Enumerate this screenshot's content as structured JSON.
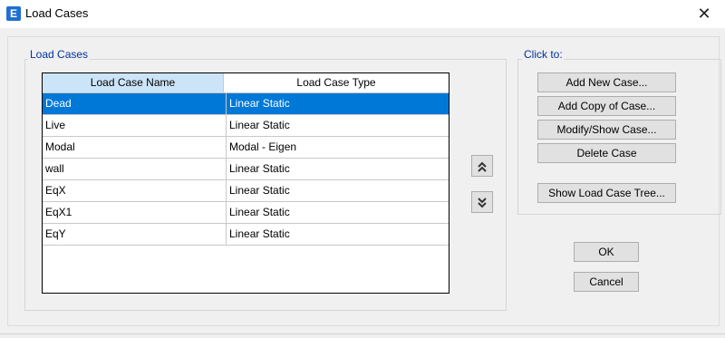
{
  "window": {
    "icon_letter": "E",
    "title": "Load Cases",
    "close_glyph": "✕"
  },
  "load_cases_group": {
    "legend": "Load Cases",
    "columns": [
      "Load Case Name",
      "Load Case Type"
    ],
    "selected_row": 0,
    "rows": [
      {
        "name": "Dead",
        "type": "Linear Static"
      },
      {
        "name": "Live",
        "type": "Linear Static"
      },
      {
        "name": "Modal",
        "type": "Modal - Eigen"
      },
      {
        "name": "wall",
        "type": "Linear Static"
      },
      {
        "name": "EqX",
        "type": "Linear Static"
      },
      {
        "name": "EqX1",
        "type": "Linear Static"
      },
      {
        "name": "EqY",
        "type": "Linear Static"
      }
    ]
  },
  "reorder": {
    "move_up_icon": "double-chevron-up-icon",
    "move_up_glyph": "⌃⌃",
    "move_down_icon": "double-chevron-down-icon",
    "move_down_glyph": "⌄⌄"
  },
  "click_to_group": {
    "legend": "Click to:",
    "add_new": "Add New Case...",
    "add_copy": "Add Copy of Case...",
    "modify_show": "Modify/Show Case...",
    "delete": "Delete Case",
    "show_tree": "Show Load Case Tree..."
  },
  "dialog_buttons": {
    "ok": "OK",
    "cancel": "Cancel"
  },
  "colors": {
    "selection": "#0078d7",
    "header_highlight": "#cce4f7",
    "legend_text": "#0033a0"
  }
}
